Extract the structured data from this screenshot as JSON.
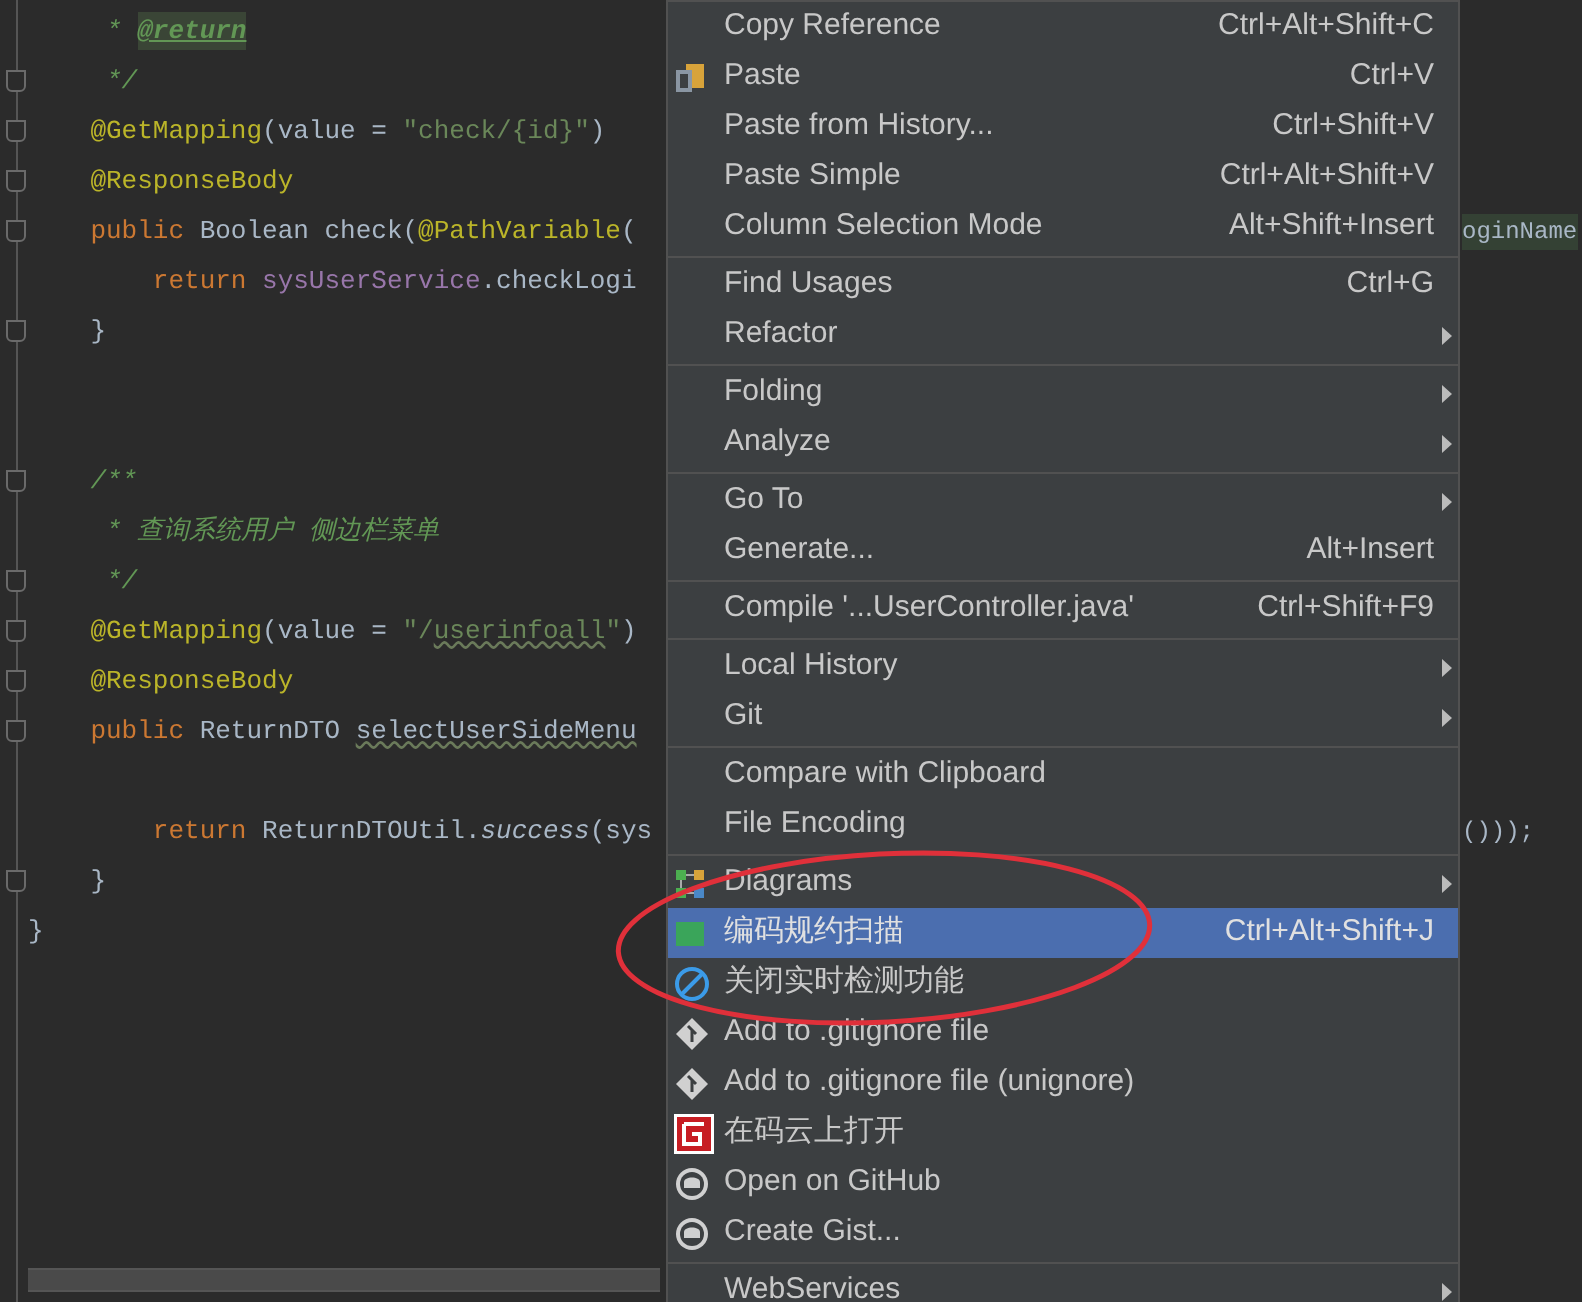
{
  "editor": {
    "lines": [
      {
        "fold": false,
        "tokens": [
          {
            "text": "     * ",
            "kind": "doc"
          },
          {
            "text": "@return",
            "kind": "doc_tag",
            "highlighted": true
          }
        ]
      },
      {
        "fold": true,
        "tokens": [
          {
            "text": "     */",
            "kind": "doc"
          }
        ]
      },
      {
        "fold": true,
        "tokens": [
          {
            "text": "    @GetMapping",
            "kind": "annotation"
          },
          {
            "text": "(value = ",
            "kind": "plain"
          },
          {
            "text": "\"check/{id}\"",
            "kind": "string"
          },
          {
            "text": ")",
            "kind": "plain"
          }
        ]
      },
      {
        "fold": true,
        "tokens": [
          {
            "text": "    @ResponseBody",
            "kind": "annotation"
          }
        ]
      },
      {
        "fold": true,
        "tokens": [
          {
            "text": "    public ",
            "kind": "keyword"
          },
          {
            "text": "Boolean check(",
            "kind": "plain"
          },
          {
            "text": "@PathVariable",
            "kind": "annotation"
          },
          {
            "text": "(",
            "kind": "plain"
          }
        ],
        "tail": {
          "text": "oginName",
          "highlighted": true
        }
      },
      {
        "fold": false,
        "tokens": [
          {
            "text": "        return ",
            "kind": "keyword"
          },
          {
            "text": "sysUserService",
            "kind": "field"
          },
          {
            "text": ".checkLogi",
            "kind": "plain"
          }
        ]
      },
      {
        "fold": true,
        "tokens": [
          {
            "text": "    }",
            "kind": "plain"
          }
        ]
      },
      {
        "fold": false
      },
      {
        "fold": false
      },
      {
        "fold": true,
        "tokens": [
          {
            "text": "    /**",
            "kind": "doc"
          }
        ]
      },
      {
        "fold": false,
        "tokens": [
          {
            "text": "     * 查询系统用户 侧边栏菜单",
            "kind": "doc"
          }
        ]
      },
      {
        "fold": true,
        "tokens": [
          {
            "text": "     */",
            "kind": "doc"
          }
        ]
      },
      {
        "fold": true,
        "tokens": [
          {
            "text": "    @GetMapping",
            "kind": "annotation"
          },
          {
            "text": "(value = ",
            "kind": "plain"
          },
          {
            "text": "\"/",
            "kind": "string"
          },
          {
            "text": "userinfoall",
            "kind": "string",
            "warning": true
          },
          {
            "text": "\"",
            "kind": "string"
          },
          {
            "text": ")",
            "kind": "plain"
          }
        ]
      },
      {
        "fold": true,
        "tokens": [
          {
            "text": "    @ResponseBody",
            "kind": "annotation"
          }
        ]
      },
      {
        "fold": true,
        "tokens": [
          {
            "text": "    public ",
            "kind": "keyword"
          },
          {
            "text": "ReturnDTO ",
            "kind": "plain"
          },
          {
            "text": "selectUserSideMenu",
            "kind": "method",
            "warning": true
          }
        ]
      },
      {
        "fold": false
      },
      {
        "fold": false,
        "tokens": [
          {
            "text": "        return ",
            "kind": "keyword"
          },
          {
            "text": "ReturnDTOUtil.",
            "kind": "plain"
          },
          {
            "text": "success",
            "kind": "static"
          },
          {
            "text": "(sys",
            "kind": "plain"
          }
        ],
        "tail": {
          "text": "()));"
        }
      },
      {
        "fold": true,
        "tokens": [
          {
            "text": "    }",
            "kind": "plain"
          }
        ]
      },
      {
        "fold": false,
        "tokens": [
          {
            "text": "}",
            "kind": "plain"
          }
        ]
      }
    ]
  },
  "context_menu": {
    "items": [
      {
        "kind": "item",
        "label": "Copy Reference",
        "shortcut": "Ctrl+Alt+Shift+C",
        "submenu": false,
        "selected": false
      },
      {
        "kind": "paste",
        "label": "Paste",
        "shortcut": "Ctrl+V",
        "submenu": false,
        "selected": false
      },
      {
        "kind": "item",
        "label": "Paste from History...",
        "shortcut": "Ctrl+Shift+V",
        "submenu": false,
        "selected": false
      },
      {
        "kind": "item",
        "label": "Paste Simple",
        "shortcut": "Ctrl+Alt+Shift+V",
        "submenu": false,
        "selected": false
      },
      {
        "kind": "item",
        "label": "Column Selection Mode",
        "shortcut": "Alt+Shift+Insert",
        "submenu": false,
        "selected": false
      },
      {
        "kind": "separator"
      },
      {
        "kind": "item",
        "label": "Find Usages",
        "shortcut": "Ctrl+G",
        "submenu": false,
        "selected": false
      },
      {
        "kind": "item",
        "label": "Refactor",
        "submenu": true,
        "selected": false
      },
      {
        "kind": "separator"
      },
      {
        "kind": "item",
        "label": "Folding",
        "submenu": true,
        "selected": false
      },
      {
        "kind": "item",
        "label": "Analyze",
        "submenu": true,
        "selected": false
      },
      {
        "kind": "separator"
      },
      {
        "kind": "item",
        "label": "Go To",
        "submenu": true,
        "selected": false
      },
      {
        "kind": "item",
        "label": "Generate...",
        "shortcut": "Alt+Insert",
        "submenu": false,
        "selected": false
      },
      {
        "kind": "separator"
      },
      {
        "kind": "item",
        "label": "Compile '...UserController.java'",
        "shortcut": "Ctrl+Shift+F9",
        "submenu": false,
        "selected": false
      },
      {
        "kind": "separator"
      },
      {
        "kind": "item",
        "label": "Local History",
        "submenu": true,
        "selected": false
      },
      {
        "kind": "item",
        "label": "Git",
        "submenu": true,
        "selected": false
      },
      {
        "kind": "separator"
      },
      {
        "kind": "item",
        "label": "Compare with Clipboard",
        "submenu": false,
        "selected": false
      },
      {
        "kind": "item",
        "label": "File Encoding",
        "submenu": false,
        "selected": false
      },
      {
        "kind": "separator"
      },
      {
        "kind": "diagrams",
        "label": "Diagrams",
        "submenu": true,
        "selected": false
      },
      {
        "kind": "scan",
        "label": "编码规约扫描",
        "shortcut": "Ctrl+Alt+Shift+J",
        "submenu": false,
        "selected": true
      },
      {
        "kind": "block",
        "label": "关闭实时检测功能",
        "submenu": false,
        "selected": false
      },
      {
        "kind": "git",
        "label": "Add to .gitignore file",
        "submenu": false,
        "selected": false
      },
      {
        "kind": "git",
        "label": "Add to .gitignore file (unignore)",
        "submenu": false,
        "selected": false
      },
      {
        "kind": "gitee",
        "label": "在码云上打开",
        "submenu": false,
        "selected": false
      },
      {
        "kind": "github",
        "label": "Open on GitHub",
        "submenu": false,
        "selected": false
      },
      {
        "kind": "github",
        "label": "Create Gist...",
        "submenu": false,
        "selected": false
      },
      {
        "kind": "separator"
      },
      {
        "kind": "item",
        "label": "WebServices",
        "submenu": true,
        "selected": false
      }
    ]
  }
}
